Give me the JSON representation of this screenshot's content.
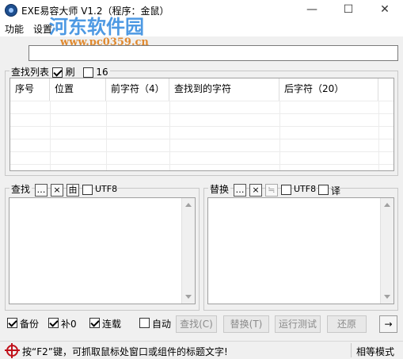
{
  "window": {
    "title": "EXE易容大师 V1.2（程序：金鼠）",
    "minimize_icon": "—",
    "maximize_icon": "☐",
    "close_icon": "✕"
  },
  "menu": {
    "items": [
      "功能",
      "设置"
    ]
  },
  "watermark": {
    "text": "河东软件园",
    "url": "www.pc0359.cn"
  },
  "search_list": {
    "label": "查找列表",
    "refresh_label": "刷",
    "refresh_checked": true,
    "hex16_label": "16",
    "hex16_checked": false,
    "columns": [
      "序号",
      "位置",
      "前字符（4）",
      "查找到的字符",
      "后字符（20）"
    ]
  },
  "find_panel": {
    "label": "查找",
    "more_button": "…",
    "clear_button": "×",
    "from_button": "由",
    "utf8_label": "UTF8",
    "utf8_checked": false
  },
  "replace_panel": {
    "label": "替换",
    "more_button": "…",
    "clear_button": "×",
    "swap_button": "≒",
    "utf8_label": "UTF8",
    "utf8_checked": false,
    "translate_label": "译",
    "translate_checked": false
  },
  "options": {
    "backup": {
      "label": "备份",
      "checked": true
    },
    "pad_zero": {
      "label": "补0",
      "checked": true
    },
    "continuous": {
      "label": "连载",
      "checked": true
    },
    "auto": {
      "label": "自动",
      "checked": false
    }
  },
  "buttons": {
    "find": "查找(C)",
    "replace": "替换(T)",
    "test_run": "运行测试",
    "restore": "还原",
    "arrow": "→"
  },
  "status": {
    "message": "按“F2”键，可抓取鼠标处窗口或组件的标题文字!",
    "mode": "相等模式"
  }
}
